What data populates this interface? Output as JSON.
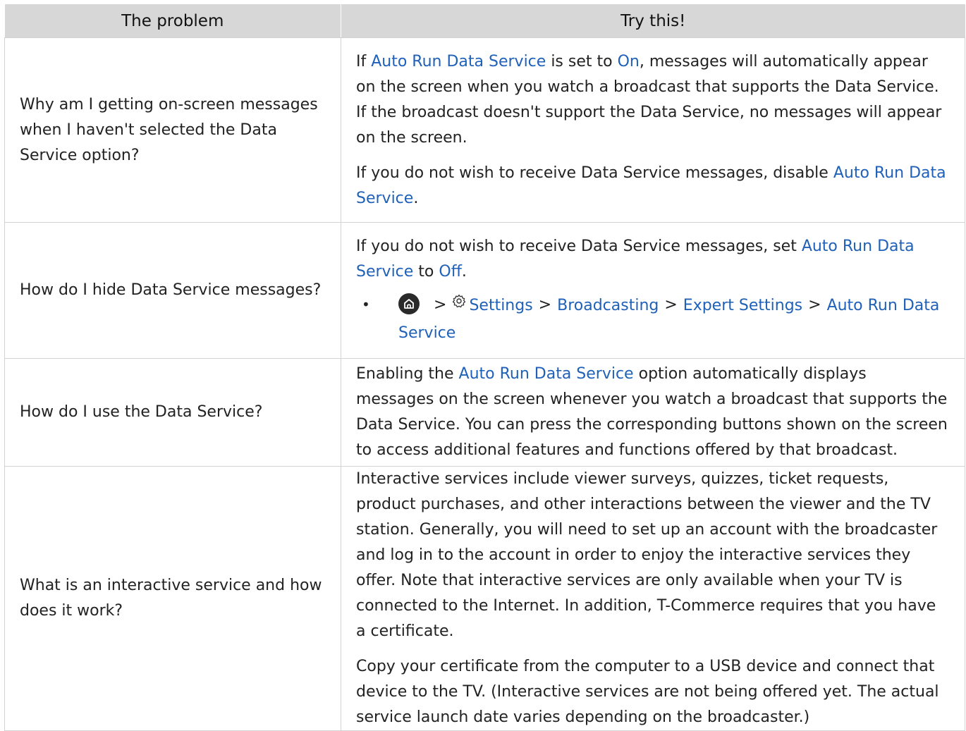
{
  "header": {
    "col_problem": "The problem",
    "col_try": "Try this!"
  },
  "rows": [
    {
      "question": "Why am I getting on-screen messages when I haven't selected the Data Service option?",
      "p1": {
        "t1": "If ",
        "l1": "Auto Run Data Service",
        "t2": " is set to ",
        "l2": "On",
        "t3": ", messages will automatically appear on the screen when you watch a broadcast that supports the Data Service. If the broadcast doesn't support the Data Service, no messages will appear on the screen."
      },
      "p2": {
        "t1": "If you do not wish to receive Data Service messages, disable ",
        "l1": "Auto Run Data Service",
        "t2": "."
      }
    },
    {
      "question": "How do I hide Data Service messages?",
      "p1": {
        "t1": "If you do not wish to receive Data Service messages, set ",
        "l1": "Auto Run Data Service",
        "t2": " to ",
        "l2": "Off",
        "t3": "."
      },
      "path": {
        "bullet": "•",
        "chevron": ">",
        "settings": "Settings",
        "broadcasting": "Broadcasting",
        "expert": "Expert Settings",
        "auto_run": "Auto Run Data Service"
      }
    },
    {
      "question": "How do I use the Data Service?",
      "p1": {
        "t1": "Enabling the ",
        "l1": "Auto Run Data Service",
        "t2": " option automatically displays messages on the screen whenever you watch a broadcast that supports the Data Service. You can press the corresponding buttons shown on the screen to access additional features and functions offered by that broadcast."
      }
    },
    {
      "question": "What is an interactive service and how does it work?",
      "p1": "Interactive services include viewer surveys, quizzes, ticket requests, product purchases, and other interactions between the viewer and the TV station. Generally, you will need to set up an account with the broadcaster and log in to the account in order to enjoy the interactive services they offer. Note that interactive services are only available when your TV is connected to the Internet. In addition, T-Commerce requires that you have a certificate.",
      "p2": "Copy your certificate from the computer to a USB device and connect that device to the TV. (Interactive services are not being offered yet. The actual service launch date varies depending on the broadcaster.)"
    }
  ],
  "colors": {
    "header_bg": "#d7d7d7",
    "link": "#1f61b8",
    "text": "#222222",
    "border": "#d3d3d3"
  },
  "icons": [
    "home-icon",
    "gear-icon",
    "chevron-right-icon"
  ]
}
